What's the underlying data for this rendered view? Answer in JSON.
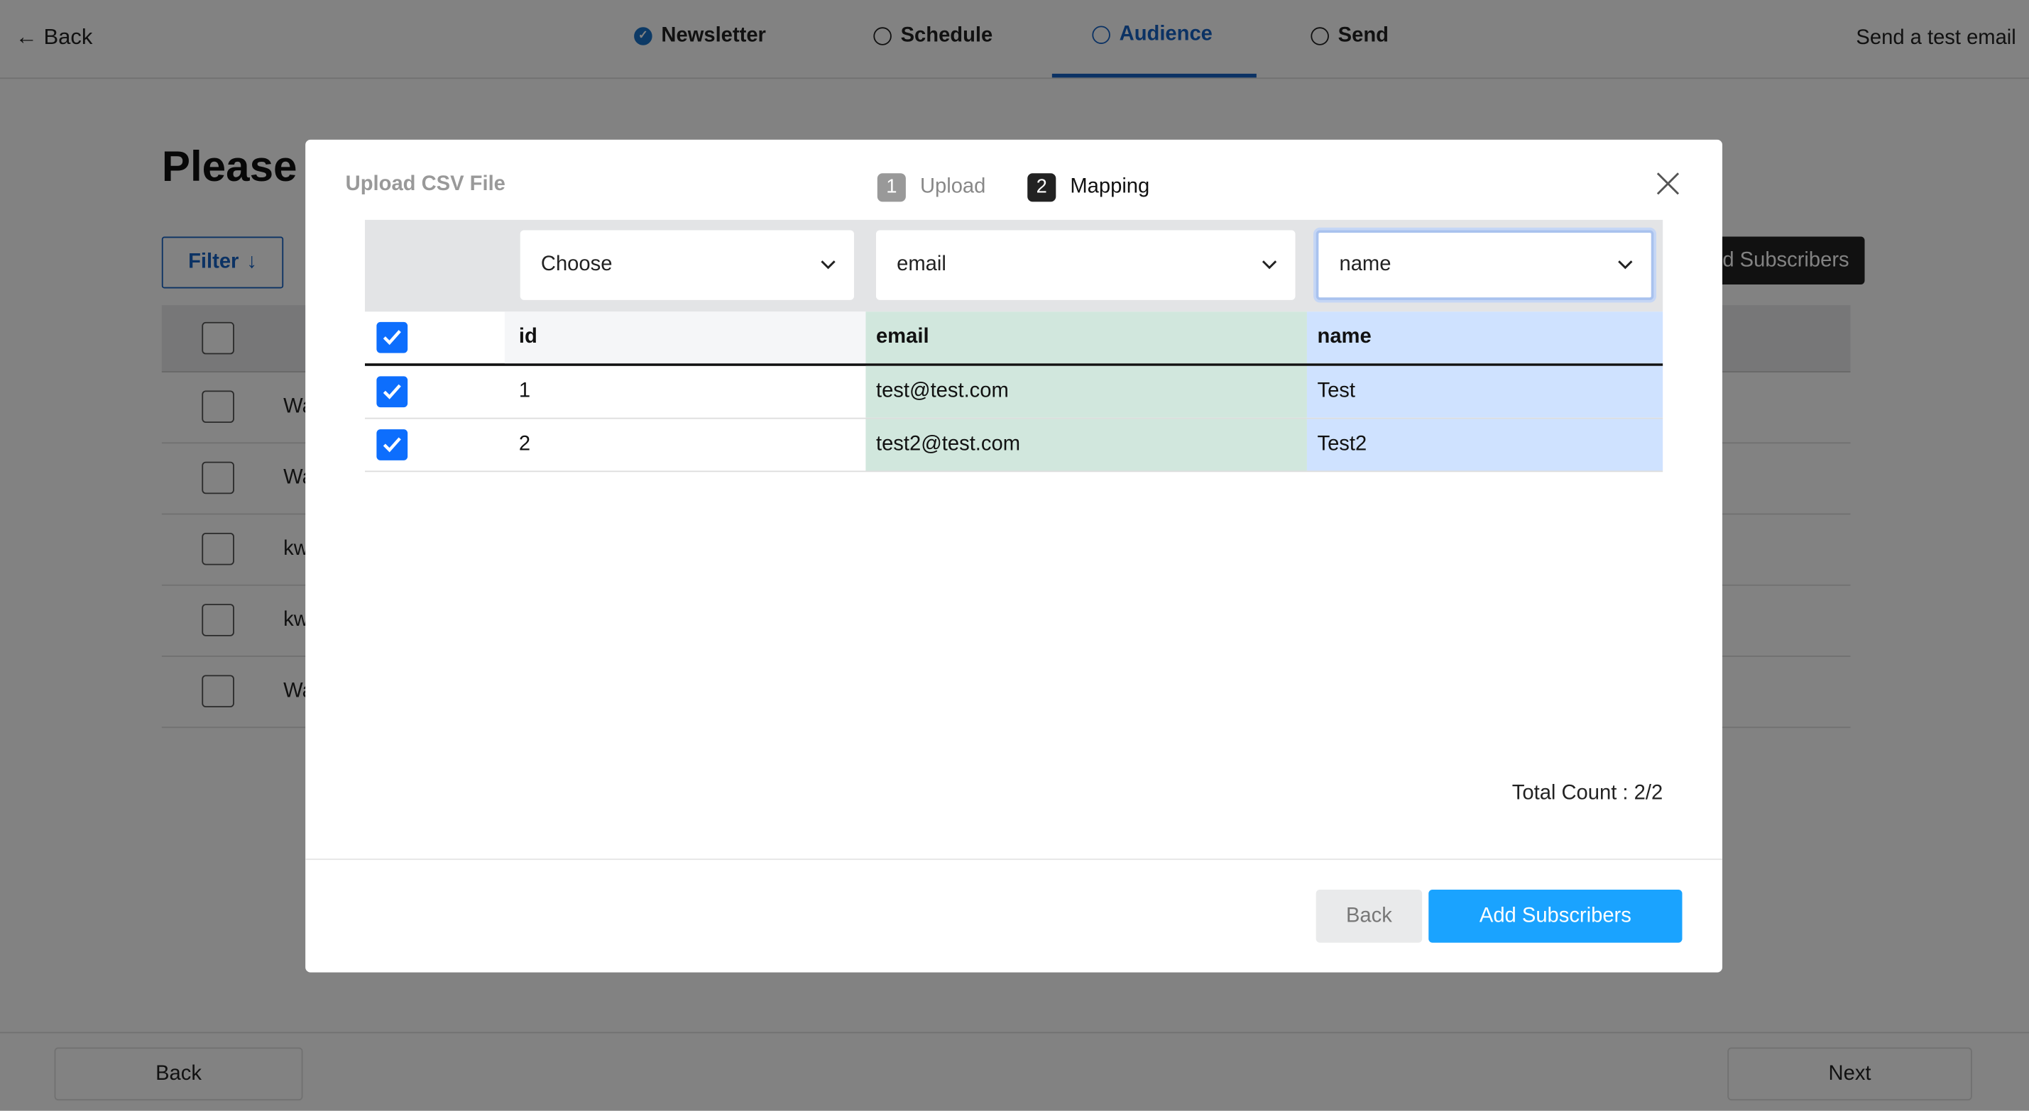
{
  "topbar": {
    "back_label": "Back",
    "send_test_label": "Send a test email",
    "steps": [
      {
        "label": "Newsletter",
        "state": "done"
      },
      {
        "label": "Schedule",
        "state": "todo"
      },
      {
        "label": "Audience",
        "state": "active"
      },
      {
        "label": "Send",
        "state": "todo"
      }
    ]
  },
  "page": {
    "title": "Please",
    "filter_label": "Filter",
    "add_subscribers_label": "d Subscribers",
    "rows": [
      "Wa",
      "Wa",
      "kw",
      "kw",
      "Wa"
    ],
    "bottom": {
      "back_label": "Back",
      "next_label": "Next"
    }
  },
  "modal": {
    "title": "Upload CSV File",
    "steps": [
      {
        "number": "1",
        "label": "Upload",
        "state": "done"
      },
      {
        "number": "2",
        "label": "Mapping",
        "state": "active"
      }
    ],
    "mapping": [
      "Choose",
      "email",
      "name"
    ],
    "headers": [
      "id",
      "email",
      "name"
    ],
    "rows": [
      {
        "checked": true,
        "id": "1",
        "email": "test@test.com",
        "name": "Test"
      },
      {
        "checked": true,
        "id": "2",
        "email": "test2@test.com",
        "name": "Test2"
      }
    ],
    "total_count": "Total Count : 2/2",
    "back_label": "Back",
    "submit_label": "Add Subscribers"
  },
  "colors": {
    "accent": "#1762c4",
    "primary_button": "#1aa3ff",
    "email_col": "#d1e7dd",
    "name_col": "#cfe2ff",
    "checkbox": "#0d6efd"
  }
}
